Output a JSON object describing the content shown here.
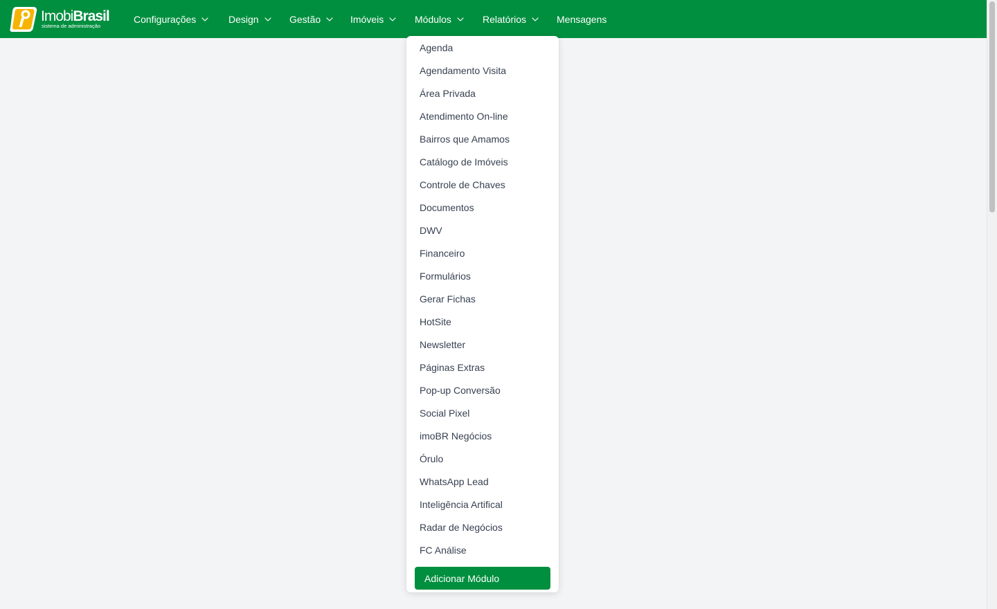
{
  "brand": {
    "name_light": "Imobi",
    "name_bold": "Brasil",
    "tagline": "sistema de administração",
    "accent_color": "#008f3f",
    "logo_icon": "imobibrasil-logo-icon"
  },
  "nav": {
    "items": [
      {
        "label": "Configurações",
        "has_dropdown": true
      },
      {
        "label": "Design",
        "has_dropdown": true
      },
      {
        "label": "Gestão",
        "has_dropdown": true
      },
      {
        "label": "Imóveis",
        "has_dropdown": true
      },
      {
        "label": "Módulos",
        "has_dropdown": true
      },
      {
        "label": "Relatórios",
        "has_dropdown": true
      },
      {
        "label": "Mensagens",
        "has_dropdown": false
      }
    ]
  },
  "modules_menu": {
    "items": [
      "Agenda",
      "Agendamento Visita",
      "Área Privada",
      "Atendimento On-line",
      "Bairros que Amamos",
      "Catálogo de Imóveis",
      "Controle de Chaves",
      "Documentos",
      "DWV",
      "Financeiro",
      "Formulários",
      "Gerar Fichas",
      "HotSite",
      "Newsletter",
      "Páginas Extras",
      "Pop-up Conversão",
      "Social Pixel",
      "imoBR Negócios",
      "Órulo",
      "WhatsApp Lead",
      "Inteligência Artifical",
      "Radar de Negócios",
      "FC Análise"
    ],
    "add_button_label": "Adicionar Módulo"
  }
}
